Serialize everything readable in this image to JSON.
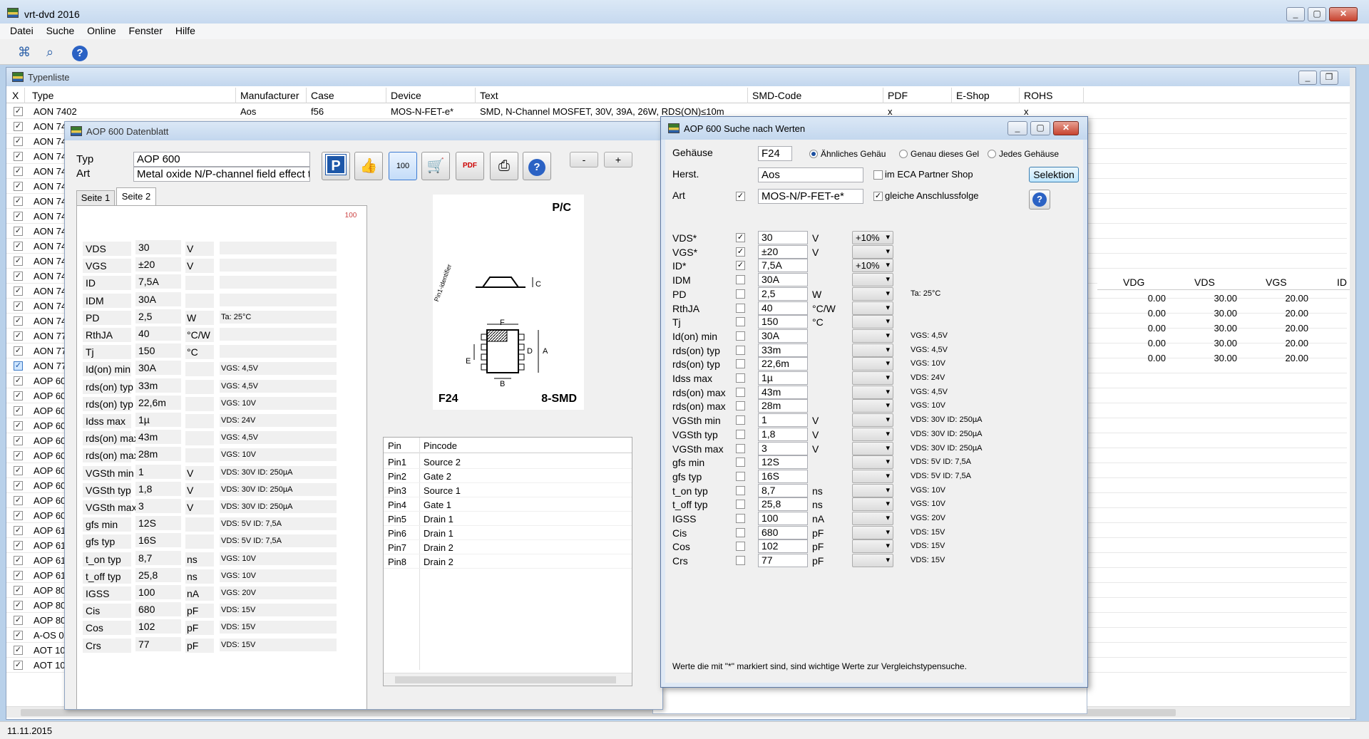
{
  "app": {
    "title": "vrt-dvd 2016",
    "status_date": "11.11.2015"
  },
  "menu": [
    "Datei",
    "Suche",
    "Online",
    "Fenster",
    "Hilfe"
  ],
  "typenliste": {
    "title": "Typenliste",
    "columns": [
      "X",
      "Type",
      "Manufacturer",
      "Case",
      "Device",
      "Text",
      "SMD-Code",
      "PDF",
      "E-Shop",
      "ROHS"
    ],
    "first_row": {
      "type": "AON 7402",
      "manufacturer": "Aos",
      "case": "f56",
      "device": "MOS-N-FET-e*",
      "text": "SMD, N-Channel MOSFET, 30V, 39A, 26W, RDS(ON)≤10m",
      "pdf": "x",
      "rohs": "x"
    },
    "types": [
      "AON 74",
      "AON 74",
      "AON 74",
      "AON 74",
      "AON 74",
      "AON 74",
      "AON 74",
      "AON 74",
      "AON 74",
      "AON 74",
      "AON 74",
      "AON 74",
      "AON 74",
      "AON 74",
      "AON 77",
      "AON 77",
      "AON 77",
      "AOP 60",
      "AOP 60",
      "AOP 60",
      "AOP 60",
      "AOP 60",
      "AOP 60",
      "AOP 60",
      "AOP 60",
      "AOP 60",
      "AOP 60",
      "AOP 61",
      "AOP 61",
      "AOP 61",
      "AOP 61",
      "AOP 80",
      "AOP 80",
      "AOP 80",
      "A-OS 0",
      "AOT 10",
      "AOT 10"
    ],
    "right_columns": [
      "VDG",
      "VDS",
      "VGS",
      "ID"
    ],
    "right_rows": [
      [
        "0.00",
        "30.00",
        "20.00"
      ],
      [
        "0.00",
        "30.00",
        "20.00"
      ],
      [
        "0.00",
        "30.00",
        "20.00"
      ],
      [
        "0.00",
        "30.00",
        "20.00"
      ],
      [
        "0.00",
        "30.00",
        "20.00"
      ]
    ]
  },
  "datenblatt": {
    "title": "AOP 600 Datenblatt",
    "typ_label": "Typ",
    "typ_value": "AOP 600",
    "art_label": "Art",
    "art_value": "Metal oxide N/P-channel field effect tra",
    "tabs": [
      "Seite 1",
      "Seite 2"
    ],
    "minus": "-",
    "plus": "+",
    "params": [
      {
        "name": "VDS",
        "value": "30",
        "unit": "V",
        "cond": ""
      },
      {
        "name": "VGS",
        "value": "±20",
        "unit": "V",
        "cond": ""
      },
      {
        "name": "ID",
        "value": "7,5A",
        "unit": "",
        "cond": ""
      },
      {
        "name": "IDM",
        "value": "30A",
        "unit": "",
        "cond": ""
      },
      {
        "name": "PD",
        "value": "2,5",
        "unit": "W",
        "cond": "Ta: 25°C"
      },
      {
        "name": "RthJA",
        "value": "40",
        "unit": "°C/W",
        "cond": ""
      },
      {
        "name": "Tj",
        "value": "150",
        "unit": "°C",
        "cond": ""
      },
      {
        "name": "Id(on) min",
        "value": "30A",
        "unit": "",
        "cond": "VGS: 4,5V"
      },
      {
        "name": "rds(on) typ",
        "value": "33m",
        "unit": "",
        "cond": "VGS: 4,5V"
      },
      {
        "name": "rds(on) typ",
        "value": "22,6m",
        "unit": "",
        "cond": "VGS: 10V"
      },
      {
        "name": "Idss max",
        "value": "1µ",
        "unit": "",
        "cond": "VDS: 24V"
      },
      {
        "name": "rds(on) max",
        "value": "43m",
        "unit": "",
        "cond": "VGS: 4,5V"
      },
      {
        "name": "rds(on) max",
        "value": "28m",
        "unit": "",
        "cond": "VGS: 10V"
      },
      {
        "name": "VGSth min",
        "value": "1",
        "unit": "V",
        "cond": "VDS: 30V ID: 250µA"
      },
      {
        "name": "VGSth typ",
        "value": "1,8",
        "unit": "V",
        "cond": "VDS: 30V ID: 250µA"
      },
      {
        "name": "VGSth max",
        "value": "3",
        "unit": "V",
        "cond": "VDS: 30V ID: 250µA"
      },
      {
        "name": "gfs min",
        "value": "12S",
        "unit": "",
        "cond": "VDS: 5V ID: 7,5A"
      },
      {
        "name": "gfs typ",
        "value": "16S",
        "unit": "",
        "cond": "VDS: 5V ID: 7,5A"
      },
      {
        "name": "t_on typ",
        "value": "8,7",
        "unit": "ns",
        "cond": "VGS: 10V"
      },
      {
        "name": "t_off typ",
        "value": "25,8",
        "unit": "ns",
        "cond": "VGS: 10V"
      },
      {
        "name": "IGSS",
        "value": "100",
        "unit": "nA",
        "cond": "VGS: 20V"
      },
      {
        "name": "Cis",
        "value": "680",
        "unit": "pF",
        "cond": "VDS: 15V"
      },
      {
        "name": "Cos",
        "value": "102",
        "unit": "pF",
        "cond": "VDS: 15V"
      },
      {
        "name": "Crs",
        "value": "77",
        "unit": "pF",
        "cond": "VDS: 15V"
      }
    ],
    "diagram": {
      "topright": "P/C",
      "case": "F24",
      "package": "8-SMD",
      "pin1": "Pin1-identifier",
      "dims": [
        "C",
        "F",
        "D",
        "A",
        "E",
        "B"
      ]
    },
    "pins": {
      "headers": [
        "Pin",
        "Pincode"
      ],
      "rows": [
        [
          "Pin1",
          "Source 2"
        ],
        [
          "Pin2",
          "Gate 2"
        ],
        [
          "Pin3",
          "Source 1"
        ],
        [
          "Pin4",
          "Gate 1"
        ],
        [
          "Pin5",
          "Drain 1"
        ],
        [
          "Pin6",
          "Drain 1"
        ],
        [
          "Pin7",
          "Drain 2"
        ],
        [
          "Pin8",
          "Drain 2"
        ]
      ]
    }
  },
  "suche": {
    "title": "AOP 600 Suche nach Werten",
    "gehaeuse_label": "Gehäuse",
    "gehaeuse_value": "F24",
    "radio_similar": "Ähnliches Gehäu",
    "radio_exact": "Genau dieses Gel",
    "radio_any": "Jedes Gehäuse",
    "herst_label": "Herst.",
    "herst_value": "Aos",
    "partner_label": "im ECA Partner Shop",
    "selektion": "Selektion",
    "art_label": "Art",
    "art_value": "MOS-N/P-FET-e*",
    "anschluss_label": "gleiche Anschlussfolge",
    "footnote": "Werte die mit \"*\" markiert sind, sind wichtige Werte zur Vergleichstypensuche.",
    "params": [
      {
        "name": "VDS*",
        "checked": "✓",
        "value": "30",
        "unit": "V",
        "tol": "+10%",
        "cond": ""
      },
      {
        "name": "VGS*",
        "checked": "✓",
        "value": "±20",
        "unit": "V",
        "tol": "",
        "cond": ""
      },
      {
        "name": "ID*",
        "checked": "✓",
        "value": "7,5A",
        "unit": "",
        "tol": "+10%",
        "cond": ""
      },
      {
        "name": "IDM",
        "checked": "",
        "value": "30A",
        "unit": "",
        "tol": "",
        "cond": ""
      },
      {
        "name": "PD",
        "checked": "",
        "value": "2,5",
        "unit": "W",
        "tol": "",
        "cond": "Ta: 25°C"
      },
      {
        "name": "RthJA",
        "checked": "",
        "value": "40",
        "unit": "°C/W",
        "tol": "",
        "cond": ""
      },
      {
        "name": "Tj",
        "checked": "",
        "value": "150",
        "unit": "°C",
        "tol": "",
        "cond": ""
      },
      {
        "name": "Id(on) min",
        "checked": "",
        "value": "30A",
        "unit": "",
        "tol": "",
        "cond": "VGS: 4,5V"
      },
      {
        "name": "rds(on) typ",
        "checked": "",
        "value": "33m",
        "unit": "",
        "tol": "",
        "cond": "VGS: 4,5V"
      },
      {
        "name": "rds(on) typ",
        "checked": "",
        "value": "22,6m",
        "unit": "",
        "tol": "",
        "cond": "VGS: 10V"
      },
      {
        "name": "Idss max",
        "checked": "",
        "value": "1µ",
        "unit": "",
        "tol": "",
        "cond": "VDS: 24V"
      },
      {
        "name": "rds(on) max",
        "checked": "",
        "value": "43m",
        "unit": "",
        "tol": "",
        "cond": "VGS: 4,5V"
      },
      {
        "name": "rds(on) max",
        "checked": "",
        "value": "28m",
        "unit": "",
        "tol": "",
        "cond": "VGS: 10V"
      },
      {
        "name": "VGSth min",
        "checked": "",
        "value": "1",
        "unit": "V",
        "tol": "",
        "cond": "VDS: 30V ID: 250µA"
      },
      {
        "name": "VGSth typ",
        "checked": "",
        "value": "1,8",
        "unit": "V",
        "tol": "",
        "cond": "VDS: 30V ID: 250µA"
      },
      {
        "name": "VGSth max",
        "checked": "",
        "value": "3",
        "unit": "V",
        "tol": "",
        "cond": "VDS: 30V ID: 250µA"
      },
      {
        "name": "gfs min",
        "checked": "",
        "value": "12S",
        "unit": "",
        "tol": "",
        "cond": "VDS: 5V ID: 7,5A"
      },
      {
        "name": "gfs typ",
        "checked": "",
        "value": "16S",
        "unit": "",
        "tol": "",
        "cond": "VDS: 5V ID: 7,5A"
      },
      {
        "name": "t_on typ",
        "checked": "",
        "value": "8,7",
        "unit": "ns",
        "tol": "",
        "cond": "VGS: 10V"
      },
      {
        "name": "t_off typ",
        "checked": "",
        "value": "25,8",
        "unit": "ns",
        "tol": "",
        "cond": "VGS: 10V"
      },
      {
        "name": "IGSS",
        "checked": "",
        "value": "100",
        "unit": "nA",
        "tol": "",
        "cond": "VGS: 20V"
      },
      {
        "name": "Cis",
        "checked": "",
        "value": "680",
        "unit": "pF",
        "tol": "",
        "cond": "VDS: 15V"
      },
      {
        "name": "Cos",
        "checked": "",
        "value": "102",
        "unit": "pF",
        "tol": "",
        "cond": "VDS: 15V"
      },
      {
        "name": "Crs",
        "checked": "",
        "value": "77",
        "unit": "pF",
        "tol": "",
        "cond": "VDS: 15V"
      }
    ]
  },
  "icons": {
    "checkmark": "✓",
    "help": "?",
    "search": "⌕",
    "parking": "P",
    "thumb": "👍",
    "cart": "🛒",
    "pdf": "PDF",
    "print": "⎙"
  }
}
